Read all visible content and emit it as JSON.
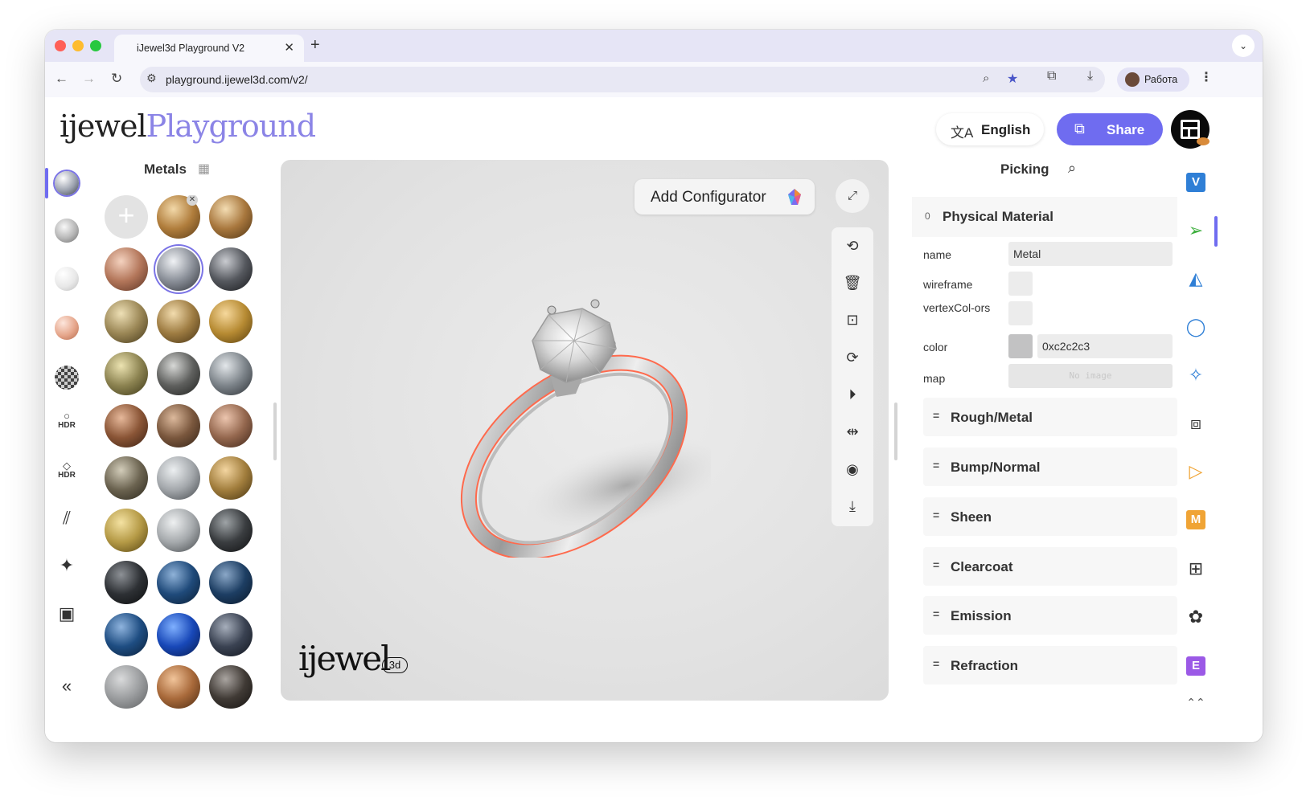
{
  "browser": {
    "tab_title": "iJewel3d Playground V2",
    "tab_close": "✕",
    "new_tab": "+",
    "url": "playground.ijewel3d.com/v2/",
    "profile_name": "Работа"
  },
  "header": {
    "logo_part1": "ijewel",
    "logo_part2": "Playground",
    "language_label": "English",
    "share_label": "Share"
  },
  "materials": {
    "title": "Metals",
    "add_symbol": "+",
    "remove_symbol": "✕",
    "swatches": [
      {
        "c1": "#f2d8a8",
        "c2": "#b07d3c",
        "c3": "#5a3b16"
      },
      {
        "c1": "#f3dcb2",
        "c2": "#a8773d",
        "c3": "#4e3313"
      },
      {
        "c1": "#f4d2bf",
        "c2": "#b3765a",
        "c3": "#5a3222"
      },
      {
        "c1": "#f0f2f5",
        "c2": "#8a8f98",
        "c3": "#2f3238"
      },
      {
        "c1": "#c9cbd0",
        "c2": "#55585e",
        "c3": "#17181b"
      },
      {
        "c1": "#eee0b6",
        "c2": "#9b8756",
        "c3": "#433719"
      },
      {
        "c1": "#f2dcae",
        "c2": "#9e7c42",
        "c3": "#463213"
      },
      {
        "c1": "#f6d89c",
        "c2": "#b78b33",
        "c3": "#573d0c"
      },
      {
        "c1": "#ece3b1",
        "c2": "#8c8351",
        "c3": "#3b3616"
      },
      {
        "c1": "#d7d8d6",
        "c2": "#5f605e",
        "c3": "#1f201e"
      },
      {
        "c1": "#e3e7ea",
        "c2": "#7d848a",
        "c3": "#2a2e33"
      },
      {
        "c1": "#e6b89a",
        "c2": "#8a5536",
        "c3": "#3a2012"
      },
      {
        "c1": "#dcb99c",
        "c2": "#7a573d",
        "c3": "#332216"
      },
      {
        "c1": "#ecc5ae",
        "c2": "#94674e",
        "c3": "#3e2518"
      },
      {
        "c1": "#d2ccb9",
        "c2": "#6b6350",
        "c3": "#2a261b"
      },
      {
        "c1": "#eceff1",
        "c2": "#a3a7ab",
        "c3": "#43474b"
      },
      {
        "c1": "#f3d5a0",
        "c2": "#a27e3d",
        "c3": "#45320f"
      },
      {
        "c1": "#f4e2a2",
        "c2": "#b59a46",
        "c3": "#54420f"
      },
      {
        "c1": "#eef0f1",
        "c2": "#a5a9ac",
        "c3": "#44484b"
      },
      {
        "c1": "#9ea3a6",
        "c2": "#3a3d40",
        "c3": "#0e0f10"
      },
      {
        "c1": "#8d9196",
        "c2": "#2d3034",
        "c3": "#0b0c0d"
      },
      {
        "c1": "#8fb2d8",
        "c2": "#1f4a7a",
        "c3": "#0a1d33"
      },
      {
        "c1": "#8aa7c7",
        "c2": "#1d3e63",
        "c3": "#0a1728"
      },
      {
        "c1": "#8fb4de",
        "c2": "#1e4d82",
        "c3": "#0a1e37"
      },
      {
        "c1": "#7fb0ff",
        "c2": "#1848b8",
        "c3": "#071a4d"
      },
      {
        "c1": "#a6aebb",
        "c2": "#3a4252",
        "c3": "#10141c"
      },
      {
        "c1": "#d9dadb",
        "c2": "#9a9c9e",
        "c3": "#5d5f61"
      },
      {
        "c1": "#f1c49a",
        "c2": "#a8693a",
        "c3": "#4b2a11"
      },
      {
        "c1": "#a9a4a0",
        "c2": "#403a35",
        "c3": "#141210"
      }
    ]
  },
  "viewport": {
    "add_configurator_label": "Add Configurator",
    "watermark": "ijewel",
    "watermark_badge": "3d"
  },
  "properties": {
    "title": "Picking",
    "section_title": "Physical Material",
    "section_toggle": "0",
    "fields": {
      "name_label": "name",
      "name_value": "Metal",
      "wireframe_label": "wireframe",
      "vertex_colors_label": "vertexCol-ors",
      "color_label": "color",
      "color_value": "0xc2c2c3",
      "color_hex": "#c2c2c3",
      "map_label": "map",
      "map_value": "No image"
    },
    "subsections": [
      {
        "label": "Rough/Metal"
      },
      {
        "label": "Bump/Normal"
      },
      {
        "label": "Sheen"
      },
      {
        "label": "Clearcoat"
      },
      {
        "label": "Emission"
      },
      {
        "label": "Refraction"
      }
    ],
    "sub_toggle": "="
  },
  "right_rail": {
    "v_badge": "V",
    "m_badge": "M",
    "e_badge": "E"
  },
  "left_rail": {
    "hdr_label": "HDR"
  },
  "colors": {
    "accent": "#6f6cf0",
    "v_badge": "#2f7fd6",
    "m_badge": "#f0a435",
    "e_badge": "#9b59e6",
    "green_icon": "#3cae3c",
    "blue_icon": "#2f7fd6",
    "orange_icon": "#f0a435",
    "ring_outline": "#ff6a4d"
  }
}
